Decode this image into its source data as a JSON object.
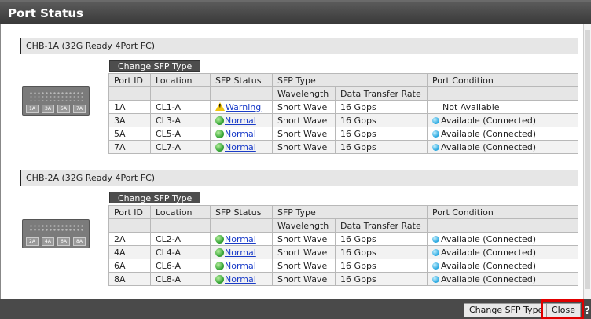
{
  "window": {
    "title": "Port Status"
  },
  "columns": {
    "port_id": "Port ID",
    "location": "Location",
    "sfp_status": "SFP Status",
    "sfp_type": "SFP Type",
    "wavelength": "Wavelength",
    "data_transfer_rate": "Data Transfer Rate",
    "port_condition": "Port Condition"
  },
  "change_sfp_label": "Change SFP Type",
  "sections": [
    {
      "title": "CHB-1A (32G Ready 4Port FC)",
      "card_ports": [
        "1A",
        "3A",
        "5A",
        "7A"
      ],
      "rows": [
        {
          "port": "1A",
          "location": "CL1-A",
          "status": "Warning",
          "status_icon": "warning-icon",
          "wavelength": "Short Wave",
          "rate": "16 Gbps",
          "condition": "Not Available"
        },
        {
          "port": "3A",
          "location": "CL3-A",
          "status": "Normal",
          "status_icon": "ok-icon",
          "wavelength": "Short Wave",
          "rate": "16 Gbps",
          "condition": "Available (Connected)"
        },
        {
          "port": "5A",
          "location": "CL5-A",
          "status": "Normal",
          "status_icon": "ok-icon",
          "wavelength": "Short Wave",
          "rate": "16 Gbps",
          "condition": "Available (Connected)"
        },
        {
          "port": "7A",
          "location": "CL7-A",
          "status": "Normal",
          "status_icon": "ok-icon",
          "wavelength": "Short Wave",
          "rate": "16 Gbps",
          "condition": "Available (Connected)"
        }
      ]
    },
    {
      "title": "CHB-2A (32G Ready 4Port FC)",
      "card_ports": [
        "2A",
        "4A",
        "6A",
        "8A"
      ],
      "rows": [
        {
          "port": "2A",
          "location": "CL2-A",
          "status": "Normal",
          "status_icon": "ok-icon",
          "wavelength": "Short Wave",
          "rate": "16 Gbps",
          "condition": "Available (Connected)"
        },
        {
          "port": "4A",
          "location": "CL4-A",
          "status": "Normal",
          "status_icon": "ok-icon",
          "wavelength": "Short Wave",
          "rate": "16 Gbps",
          "condition": "Available (Connected)"
        },
        {
          "port": "6A",
          "location": "CL6-A",
          "status": "Normal",
          "status_icon": "ok-icon",
          "wavelength": "Short Wave",
          "rate": "16 Gbps",
          "condition": "Available (Connected)"
        },
        {
          "port": "8A",
          "location": "CL8-A",
          "status": "Normal",
          "status_icon": "ok-icon",
          "wavelength": "Short Wave",
          "rate": "16 Gbps",
          "condition": "Available (Connected)"
        }
      ]
    }
  ],
  "footer": {
    "change_sfp_label": "Change SFP Type",
    "close_label": "Close",
    "help_label": "?"
  },
  "colors": {
    "link": "#1a3cc8",
    "highlight": "#e00000",
    "titlebar": "#4a4a4a"
  }
}
